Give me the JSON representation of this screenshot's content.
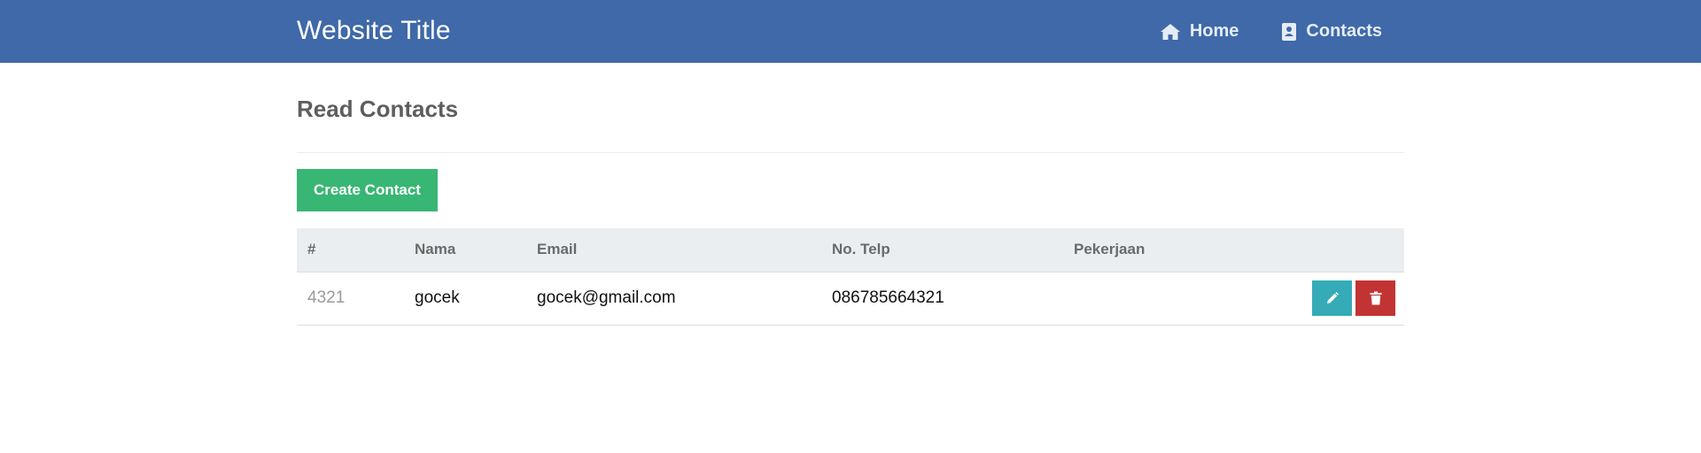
{
  "header": {
    "title": "Website Title",
    "nav": [
      {
        "label": "Home",
        "icon": "home-icon"
      },
      {
        "label": "Contacts",
        "icon": "address-book-icon"
      }
    ]
  },
  "main": {
    "title": "Read Contacts",
    "create_button_label": "Create Contact",
    "table": {
      "columns": [
        "#",
        "Nama",
        "Email",
        "No. Telp",
        "Pekerjaan"
      ],
      "rows": [
        {
          "id": "4321",
          "nama": "gocek",
          "email": "gocek@gmail.com",
          "telp": "086785664321",
          "pekerjaan": ""
        }
      ],
      "row_actions": [
        {
          "name": "edit",
          "icon": "pencil-icon",
          "color": "#35abb8"
        },
        {
          "name": "delete",
          "icon": "trash-icon",
          "color": "#c23434"
        }
      ]
    }
  },
  "colors": {
    "navbar": "#3f69a8",
    "create_button": "#38b673",
    "edit_button": "#35abb8",
    "delete_button": "#c23434",
    "table_header_bg": "#ebeef1"
  }
}
